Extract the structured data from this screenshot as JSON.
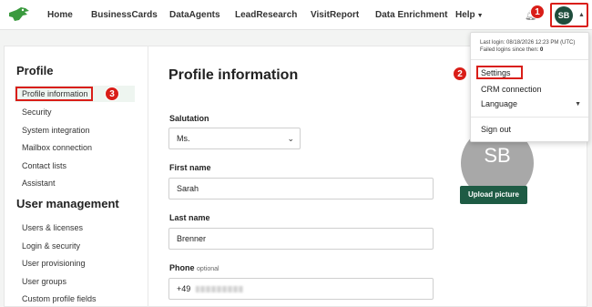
{
  "nav": {
    "items": [
      "Home",
      "BusinessCards",
      "DataAgents",
      "LeadResearch",
      "VisitReport",
      "Data Enrichment",
      "Help"
    ],
    "user_initials": "SB"
  },
  "annotations": [
    "1",
    "2",
    "3"
  ],
  "sidebar": {
    "profile_title": "Profile",
    "profile_items": [
      "Profile information",
      "Security",
      "System integration",
      "Mailbox connection",
      "Contact lists",
      "Assistant"
    ],
    "management_title": "User management",
    "management_items": [
      "Users & licenses",
      "Login & security",
      "User provisioning",
      "User groups",
      "Custom profile fields"
    ]
  },
  "main": {
    "title": "Profile information",
    "salutation_label": "Salutation",
    "salutation_value": "Ms.",
    "first_name_label": "First name",
    "first_name_value": "Sarah",
    "last_name_label": "Last name",
    "last_name_value": "Brenner",
    "phone_label": "Phone",
    "phone_optional": "optional",
    "phone_prefix": "+49",
    "avatar_initials": "SB",
    "upload_label": "Upload picture"
  },
  "user_menu": {
    "last_login": "Last login: 08/18/2026 12:23 PM (UTC)",
    "failed_logins_label": "Failed logins since then:",
    "failed_logins_count": "0",
    "items": [
      "Settings",
      "CRM connection",
      "Language",
      "Sign out"
    ]
  },
  "colors": {
    "brand_green": "#1e5b44",
    "avatar_green": "#1e4d3c",
    "highlight_red": "#d91e18",
    "active_bg": "#eef5f0"
  }
}
